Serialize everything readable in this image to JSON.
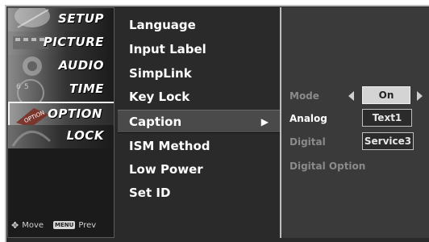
{
  "categories": [
    {
      "label": "SETUP",
      "icon": "satellite-dish-icon"
    },
    {
      "label": "PICTURE",
      "icon": "film-icon"
    },
    {
      "label": "AUDIO",
      "icon": "speaker-icon"
    },
    {
      "label": "TIME",
      "icon": "clock-icon"
    },
    {
      "label": "OPTION",
      "icon": "option-tag-icon"
    },
    {
      "label": "LOCK",
      "icon": "lock-icon"
    }
  ],
  "footer": {
    "move_label": "Move",
    "menu_key": "MENU",
    "prev_label": "Prev"
  },
  "menu": {
    "items": [
      "Language",
      "Input Label",
      "SimpLink",
      "Key Lock",
      "Caption",
      "ISM Method",
      "Low Power",
      "Set ID"
    ],
    "selected_arrow": "▶"
  },
  "caption": {
    "mode": {
      "label": "Mode",
      "value": "On"
    },
    "analog": {
      "label": "Analog",
      "value": "Text1"
    },
    "digital": {
      "label": "Digital",
      "value": "Service3"
    },
    "digital_option": {
      "label": "Digital Option"
    }
  },
  "colors": {
    "panel": "#2a2a2a",
    "selected": "#4a4a4a",
    "accent_box": "#d4d4d4"
  }
}
